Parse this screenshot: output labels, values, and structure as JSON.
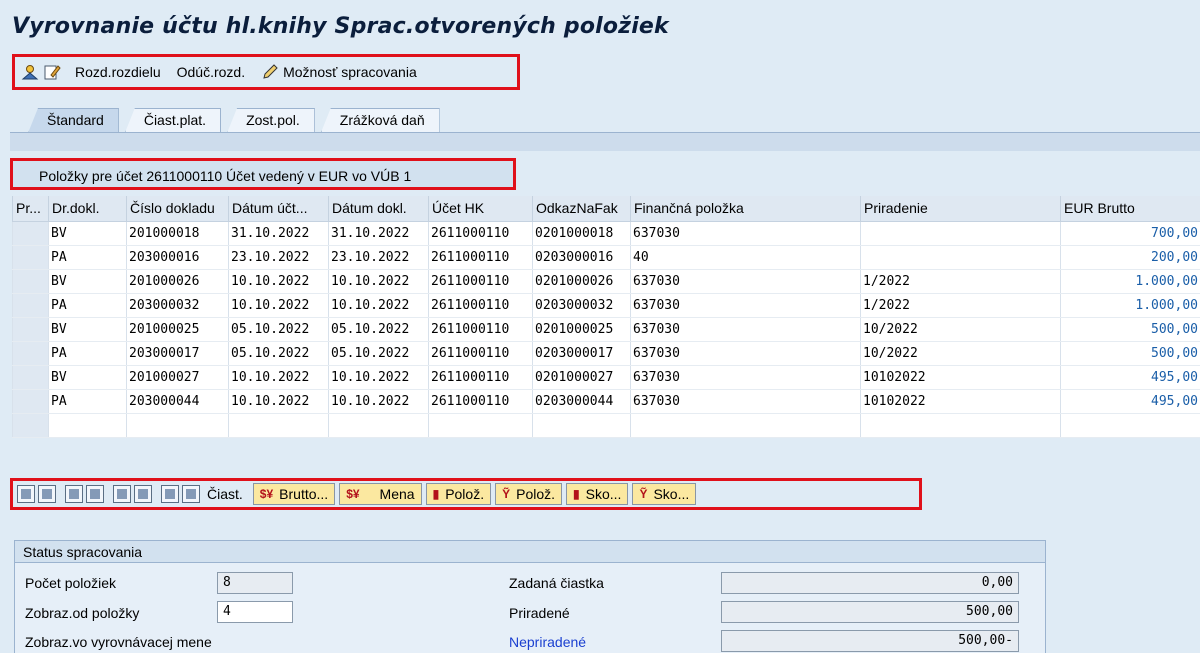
{
  "title": "Vyrovnanie účtu hl.knihy Sprac.otvorených položiek",
  "toolbar": {
    "btn1": "Rozd.rozdielu",
    "btn2": "Odúč.rozd.",
    "btn3": "Možnosť spracovania",
    "icons": [
      "person-icon",
      "edit-icon",
      "pencil-icon"
    ]
  },
  "tabs": [
    "Štandard",
    "Čiast.plat.",
    "Zost.pol.",
    "Zrážková daň"
  ],
  "section_title": "Položky pre účet 2611000110 Účet vedený v EUR vo VÚB 1",
  "table": {
    "headers": [
      "Pr...",
      "Dr.dokl.",
      "Číslo dokladu",
      "Dátum účt...",
      "Dátum dokl.",
      "Účet HK",
      "OdkazNaFak",
      "Finančná položka",
      "Priradenie",
      "EUR Brutto"
    ],
    "rows": [
      [
        "",
        "BV",
        "201000018",
        "31.10.2022",
        "31.10.2022",
        "2611000110",
        "0201000018",
        "637030",
        "",
        "700,00"
      ],
      [
        "",
        "PA",
        "203000016",
        "23.10.2022",
        "23.10.2022",
        "2611000110",
        "0203000016",
        "40",
        "",
        "200,00"
      ],
      [
        "",
        "BV",
        "201000026",
        "10.10.2022",
        "10.10.2022",
        "2611000110",
        "0201000026",
        "637030",
        "1/2022",
        "1.000,00"
      ],
      [
        "",
        "PA",
        "203000032",
        "10.10.2022",
        "10.10.2022",
        "2611000110",
        "0203000032",
        "637030",
        "1/2022",
        "1.000,00"
      ],
      [
        "",
        "BV",
        "201000025",
        "05.10.2022",
        "05.10.2022",
        "2611000110",
        "0201000025",
        "637030",
        "10/2022",
        "500,00"
      ],
      [
        "",
        "PA",
        "203000017",
        "05.10.2022",
        "05.10.2022",
        "2611000110",
        "0203000017",
        "637030",
        "10/2022",
        "500,00"
      ],
      [
        "",
        "BV",
        "201000027",
        "10.10.2022",
        "10.10.2022",
        "2611000110",
        "0201000027",
        "637030",
        "10102022",
        "495,00"
      ],
      [
        "",
        "PA",
        "203000044",
        "10.10.2022",
        "10.10.2022",
        "2611000110",
        "0203000044",
        "637030",
        "10102022",
        "495,00"
      ],
      [
        "",
        "",
        "",
        "",
        "",
        "",
        "",
        "",
        "",
        ""
      ]
    ]
  },
  "grid_toolbar": {
    "b1": "Čiast.",
    "b2": "Brutto...",
    "b3": "Mena",
    "b4": "Polož.",
    "b5": "Polož.",
    "b6": "Sko...",
    "b7": "Sko..."
  },
  "status": {
    "header": "Status spracovania",
    "pocet_label": "Počet položiek",
    "pocet_value": "8",
    "zobraz_od_label": "Zobraz.od položky",
    "zobraz_od_value": "4",
    "zobraz_vyr_label": "Zobraz.vo vyrovnávacej mene",
    "zadana_label": "Zadaná čiastka",
    "zadana_value": "0,00",
    "priradene_label": "Priradené",
    "priradene_value": "500,00",
    "nepriradene_label": "Nepriradené",
    "nepriradene_value": "500,00-",
    "nepriradene_color": "#1a3fd0"
  }
}
